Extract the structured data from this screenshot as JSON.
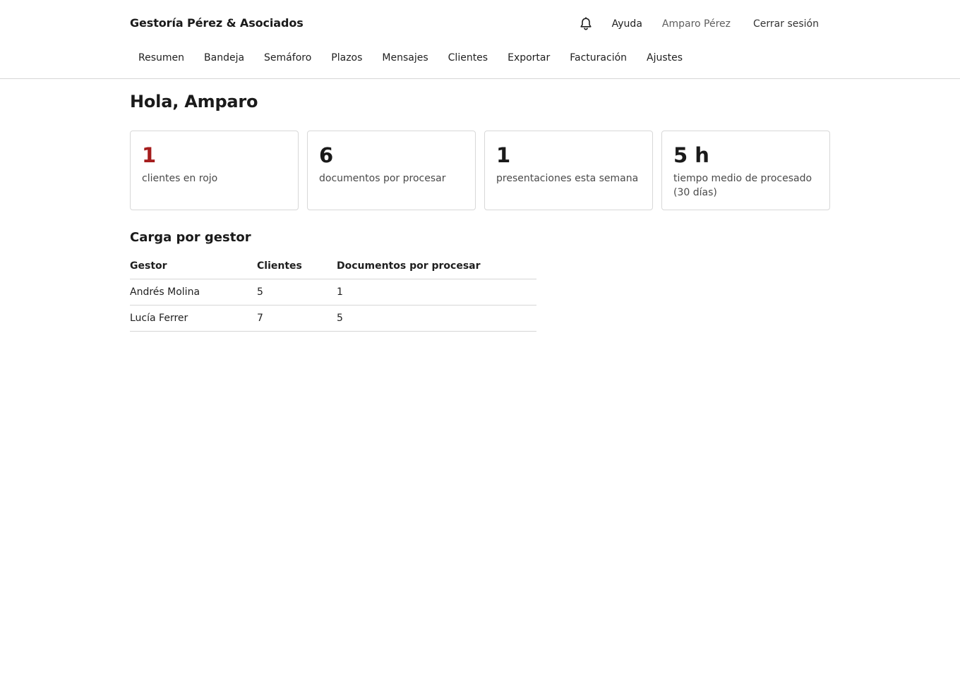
{
  "header": {
    "brand": "Gestoría Pérez & Asociados",
    "notifications_icon": "bell-icon",
    "help_label": "Ayuda",
    "user_name": "Amparo Pérez",
    "logout_label": "Cerrar sesión"
  },
  "nav": {
    "items": [
      {
        "label": "Resumen"
      },
      {
        "label": "Bandeja"
      },
      {
        "label": "Semáforo"
      },
      {
        "label": "Plazos"
      },
      {
        "label": "Mensajes"
      },
      {
        "label": "Clientes"
      },
      {
        "label": "Exportar"
      },
      {
        "label": "Facturación"
      },
      {
        "label": "Ajustes"
      }
    ]
  },
  "main": {
    "greeting": "Hola, Amparo",
    "cards": [
      {
        "value": "1",
        "label": "clientes en rojo",
        "color": "#a51d1d"
      },
      {
        "value": "6",
        "label": "documentos por procesar"
      },
      {
        "value": "1",
        "label": "presentaciones esta semana"
      },
      {
        "value": "5 h",
        "label": "tiempo medio de procesado (30 días)"
      }
    ],
    "workload": {
      "title": "Carga por gestor",
      "columns": [
        "Gestor",
        "Clientes",
        "Documentos por procesar"
      ],
      "rows": [
        [
          "Andrés Molina",
          "5",
          "1"
        ],
        [
          "Lucía Ferrer",
          "7",
          "5"
        ]
      ]
    }
  }
}
